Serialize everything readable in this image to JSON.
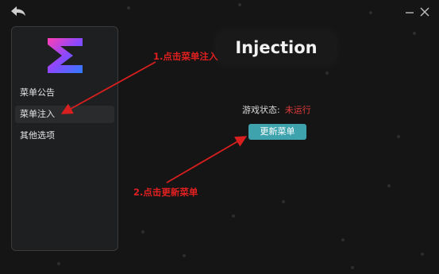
{
  "titlebar": {
    "back_icon": "back-arrow-icon",
    "minimize_icon": "minimize-icon",
    "close_icon": "close-icon"
  },
  "sidebar": {
    "logo_icon": "brand-logo-icon",
    "items": [
      {
        "label": "菜单公告"
      },
      {
        "label": "菜单注入",
        "active": true
      },
      {
        "label": "其他选项"
      }
    ]
  },
  "main": {
    "title": "Injection",
    "status_label": "游戏状态:",
    "status_value": "未运行",
    "update_button": "更新菜单"
  },
  "annotations": {
    "step1": "1.点击菜单注入",
    "step2": "2.点击更新菜单"
  },
  "colors": {
    "accent": "#3ea3ad",
    "status_error": "#e23b3b",
    "annotation": "#e02020"
  }
}
